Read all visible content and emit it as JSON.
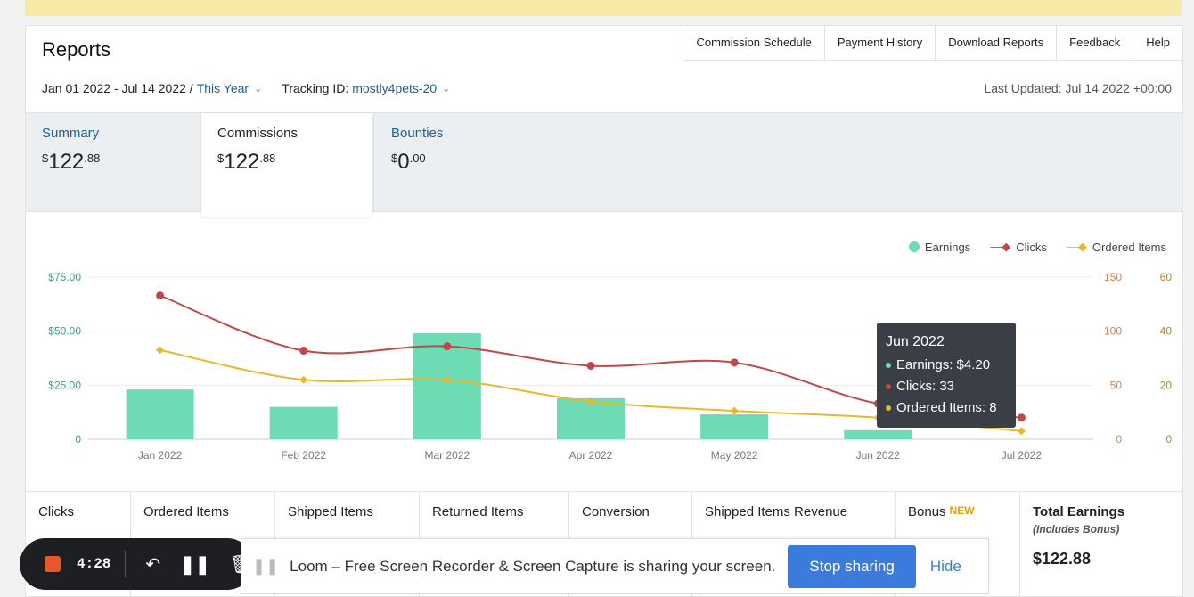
{
  "title": "Reports",
  "topnav": [
    "Commission Schedule",
    "Payment History",
    "Download Reports",
    "Feedback",
    "Help"
  ],
  "filters": {
    "date_range": "Jan 01 2022 - Jul 14 2022 /",
    "period": "This Year",
    "tracking_label": "Tracking ID:",
    "tracking_id": "mostly4pets-20"
  },
  "last_updated": "Last Updated: Jul 14 2022 +00:00",
  "tabs": [
    {
      "label": "Summary",
      "dollar": "$",
      "whole": "122",
      "cents": ".88"
    },
    {
      "label": "Commissions",
      "dollar": "$",
      "whole": "122",
      "cents": ".88"
    },
    {
      "label": "Bounties",
      "dollar": "$",
      "whole": "0",
      "cents": ".00"
    }
  ],
  "legend": {
    "earnings": "Earnings",
    "clicks": "Clicks",
    "ordered": "Ordered Items"
  },
  "colors": {
    "earnings": "#6ddbb3",
    "clicks": "#c0484a",
    "ordered": "#e6b92e",
    "link": "#1f5f8b",
    "stop_button": "#3b7bdb",
    "recorder_stop": "#e8572c"
  },
  "tooltip": {
    "title": "Jun 2022",
    "earnings": "Earnings: $4.20",
    "clicks": "Clicks: 33",
    "ordered": "Ordered Items: 8"
  },
  "chart_data": {
    "type": "bar",
    "categories": [
      "Jan 2022",
      "Feb 2022",
      "Mar 2022",
      "Apr 2022",
      "May 2022",
      "Jun 2022",
      "Jul 2022"
    ],
    "series": [
      {
        "name": "Earnings",
        "type": "bar",
        "axis": "left",
        "values": [
          23,
          15,
          49,
          19,
          11.5,
          4.2,
          0
        ]
      },
      {
        "name": "Clicks",
        "type": "line",
        "axis": "right1",
        "values": [
          133,
          82,
          86,
          68,
          71,
          33,
          20
        ]
      },
      {
        "name": "Ordered Items",
        "type": "line",
        "axis": "right2",
        "values": [
          33,
          22,
          22,
          14,
          10.5,
          8,
          3
        ]
      }
    ],
    "left_ticks": [
      "0",
      "$25.00",
      "$50.00",
      "$75.00"
    ],
    "right1_ticks": [
      "0",
      "50",
      "100",
      "150"
    ],
    "right2_ticks": [
      "0",
      "20",
      "40",
      "60"
    ],
    "ylim_left": [
      0,
      75
    ],
    "ylim_right1": [
      0,
      150
    ],
    "ylim_right2": [
      0,
      60
    ],
    "legend_position": "top-right",
    "grid": true
  },
  "metrics": {
    "clicks": "Clicks",
    "ordered": "Ordered Items",
    "shipped": "Shipped Items",
    "returned": "Returned Items",
    "conversion": "Conversion",
    "revenue": "Shipped Items Revenue",
    "bonus": "Bonus",
    "bonus_new": "NEW",
    "total_title": "Total Earnings",
    "total_sub": "(Includes Bonus)",
    "total_value": "$122.88"
  },
  "recorder": {
    "time": "4:28"
  },
  "share": {
    "message": "Loom – Free Screen Recorder & Screen Capture is sharing your screen.",
    "stop": "Stop sharing",
    "hide": "Hide"
  }
}
